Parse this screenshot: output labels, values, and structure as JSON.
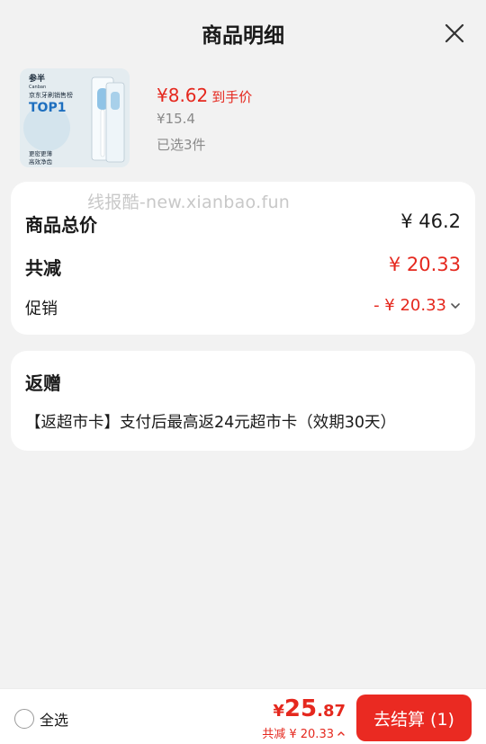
{
  "header": {
    "title": "商品明细"
  },
  "product": {
    "price": "¥8.62",
    "price_tag": "到手价",
    "original_price": "¥15.4",
    "selected_count": "已选3件",
    "image": {
      "brand": "参半",
      "brand_en": "Canban",
      "rank_line": "京东牙刷销售榜",
      "badge": "TOP1",
      "slogan_1": "更密更薄",
      "slogan_2": "高效净齿"
    }
  },
  "watermark": "线报酷-new.xianbao.fun",
  "summary": {
    "total_label": "商品总价",
    "total_value": "¥ 46.2",
    "discount_label": "共减",
    "discount_value": "¥ 20.33",
    "promo_label": "促销",
    "promo_value": "- ¥ 20.33"
  },
  "gift": {
    "title": "返赠",
    "description": "【返超市卡】支付后最高返24元超市卡（效期30天）"
  },
  "bottom": {
    "select_all_label": "全选",
    "total_currency": "¥",
    "total_int": "25",
    "total_dec": ".87",
    "discount_text": "共减 ¥ 20.33",
    "checkout_label": "去结算 (1)"
  },
  "colors": {
    "accent": "#e5281e",
    "button": "#ea2a22",
    "background": "#f2f2f2"
  },
  "icons": {
    "close": "close-icon",
    "promo_expand": "chevron-down-icon",
    "discount_expand": "chevron-up-icon"
  }
}
